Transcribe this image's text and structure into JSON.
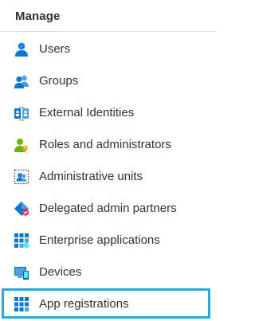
{
  "section": {
    "title": "Manage"
  },
  "nav": {
    "items": [
      {
        "label": "Users",
        "icon": "user-icon"
      },
      {
        "label": "Groups",
        "icon": "groups-icon"
      },
      {
        "label": "External Identities",
        "icon": "external-identities-icon"
      },
      {
        "label": "Roles and administrators",
        "icon": "roles-icon"
      },
      {
        "label": "Administrative units",
        "icon": "administrative-units-icon"
      },
      {
        "label": "Delegated admin partners",
        "icon": "delegated-admin-icon"
      },
      {
        "label": "Enterprise applications",
        "icon": "enterprise-apps-icon"
      },
      {
        "label": "Devices",
        "icon": "devices-icon"
      },
      {
        "label": "App registrations",
        "icon": "app-registrations-icon",
        "selected": true
      }
    ]
  },
  "colors": {
    "selected_border": "#2aa8d8",
    "text": "#323130",
    "divider": "#e1dfdd",
    "icon_blue": "#0078d4",
    "icon_light_blue": "#50e6ff",
    "icon_green": "#6bb700"
  }
}
